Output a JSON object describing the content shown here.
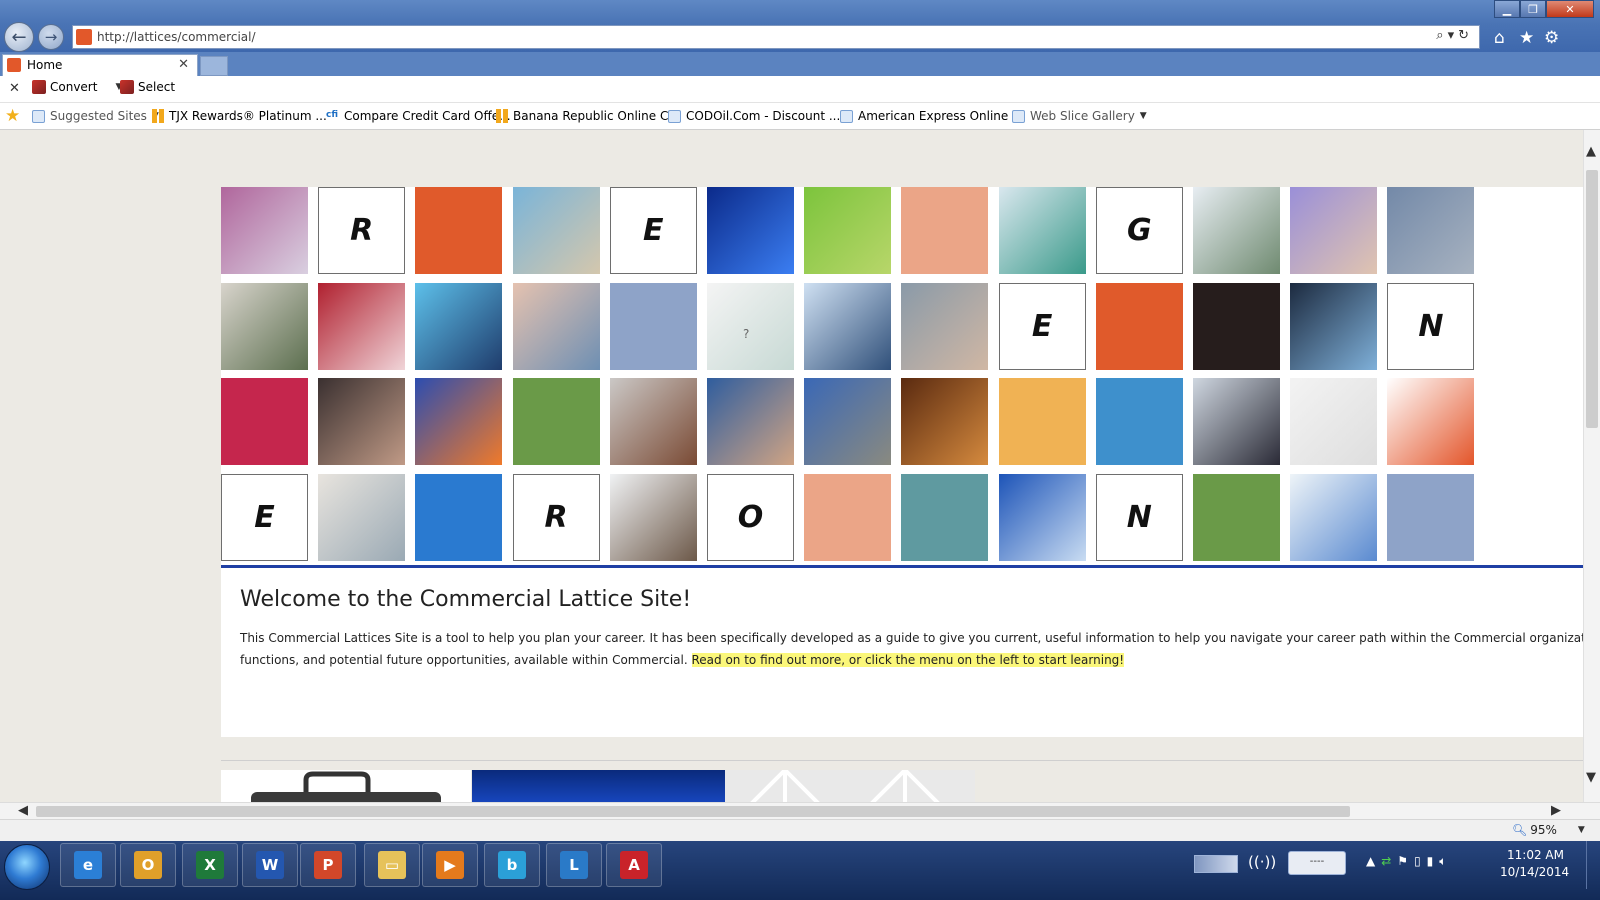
{
  "browser": {
    "address": "http://lattices/commercial/",
    "tab_label": "Home",
    "window_controls": {
      "minimize": "▁",
      "maximize": "❐",
      "close": "✕"
    },
    "icons": {
      "back": "back-arrow-icon",
      "forward": "forward-arrow-icon",
      "home": "home-icon",
      "favorites": "star-icon",
      "tools": "gear-icon",
      "search": "search-icon",
      "refresh": "refresh-icon"
    }
  },
  "commandbar": {
    "close_symbol": "✕",
    "convert_label": "Convert",
    "select_label": "Select"
  },
  "favorites": [
    {
      "label": "Suggested Sites",
      "icon": "ie-page-icon",
      "dropdown": true
    },
    {
      "label": "TJX Rewards® Platinum ...",
      "icon": "bars-icon"
    },
    {
      "label": "Compare Credit Card Offe...",
      "icon": "cc-icon"
    },
    {
      "label": "Banana Republic Online C...",
      "icon": "bars-icon"
    },
    {
      "label": "CODOil.Com - Discount ...",
      "icon": "ie-page-icon"
    },
    {
      "label": "American Express  Online ...",
      "icon": "ie-page-icon"
    },
    {
      "label": "Web Slice Gallery",
      "icon": "ie-page-icon",
      "dropdown": true
    }
  ],
  "mosaic": {
    "rows": [
      [
        {
          "type": "photo",
          "desc": "purple-tissue",
          "color": "#b0669c",
          "color2": "#d9cfe0"
        },
        {
          "type": "letter",
          "text": "R"
        },
        {
          "type": "color",
          "color": "#e05a2b"
        },
        {
          "type": "photo",
          "desc": "beach-couple",
          "color": "#7ab4d8",
          "color2": "#d4c7ad"
        },
        {
          "type": "letter",
          "text": "E"
        },
        {
          "type": "photo",
          "desc": "blue-molecule",
          "color": "#0b2a8a",
          "color2": "#3b7ef2"
        },
        {
          "type": "photo",
          "desc": "green-antibody",
          "color": "#7cc43c",
          "color2": "#b8d66a"
        },
        {
          "type": "color",
          "color": "#eba587"
        },
        {
          "type": "photo",
          "desc": "lab-scientist",
          "color": "#d9e7ee",
          "color2": "#3a9a8a"
        },
        {
          "type": "letter",
          "text": "G"
        },
        {
          "type": "photo",
          "desc": "office-presentation",
          "color": "#e7edf2",
          "color2": "#6f8a70"
        },
        {
          "type": "photo",
          "desc": "woman-portrait",
          "color": "#9a8fd8",
          "color2": "#e0c4b0"
        },
        {
          "type": "photo",
          "desc": "factory-floor",
          "color": "#7389a8",
          "color2": "#a7b2c0"
        }
      ],
      [
        {
          "type": "photo",
          "desc": "doctor-patient",
          "color": "#d8d4cc",
          "color2": "#5c6f4f"
        },
        {
          "type": "photo",
          "desc": "red-cells",
          "color": "#b0202f",
          "color2": "#f0d4d8"
        },
        {
          "type": "photo",
          "desc": "capsule-grid",
          "color": "#5dc0ea",
          "color2": "#1f3c6c"
        },
        {
          "type": "photo",
          "desc": "blue-eye",
          "color": "#e5c2b0",
          "color2": "#6e8fb2"
        },
        {
          "type": "color",
          "color": "#8ea3c8"
        },
        {
          "type": "photo",
          "desc": "vial",
          "color": "#f4f4f4",
          "color2": "#c7d9d4",
          "text": "?"
        },
        {
          "type": "photo",
          "desc": "hands-document",
          "color": "#cfe0f2",
          "color2": "#30507a"
        },
        {
          "type": "photo",
          "desc": "man-portrait",
          "color": "#8a9aa8",
          "color2": "#d0b7a4"
        },
        {
          "type": "letter",
          "text": "E"
        },
        {
          "type": "color",
          "color": "#e05a2b"
        },
        {
          "type": "color",
          "color": "#261d1c"
        },
        {
          "type": "photo",
          "desc": "trade-booth",
          "color": "#1c2a3f",
          "color2": "#7fb0d9"
        },
        {
          "type": "letter",
          "text": "N"
        }
      ],
      [
        {
          "type": "color",
          "color": "#c5264d"
        },
        {
          "type": "photo",
          "desc": "group-photo",
          "color": "#3a3030",
          "color2": "#c09a86"
        },
        {
          "type": "photo",
          "desc": "team-blue",
          "color": "#2c4db0",
          "color2": "#f07a2a"
        },
        {
          "type": "color",
          "color": "#6a9a48"
        },
        {
          "type": "photo",
          "desc": "curly-hair-woman",
          "color": "#cbc8c6",
          "color2": "#7a4a34"
        },
        {
          "type": "photo",
          "desc": "crowd",
          "color": "#2f5d9e",
          "color2": "#d0a484"
        },
        {
          "type": "photo",
          "desc": "road",
          "color": "#3a68b6",
          "color2": "#8a8a80"
        },
        {
          "type": "photo",
          "desc": "retina",
          "color": "#5a2a10",
          "color2": "#d58a3e"
        },
        {
          "type": "color",
          "color": "#f0b254"
        },
        {
          "type": "color",
          "color": "#3e90cc"
        },
        {
          "type": "photo",
          "desc": "man-suit",
          "color": "#cfd7e0",
          "color2": "#2a2a36"
        },
        {
          "type": "photo",
          "desc": "white-geometric",
          "color": "#f3f3f3",
          "color2": "#dedede"
        },
        {
          "type": "photo",
          "desc": "ribbon",
          "color": "#ffffff",
          "color2": "#e3552a"
        }
      ],
      [
        {
          "type": "letter",
          "text": "E"
        },
        {
          "type": "photo",
          "desc": "doctors-older",
          "color": "#e8e4de",
          "color2": "#9aa9b4"
        },
        {
          "type": "color",
          "color": "#2a7ad0"
        },
        {
          "type": "letter",
          "text": "R"
        },
        {
          "type": "photo",
          "desc": "microscope",
          "color": "#f0f2f4",
          "color2": "#6c5848"
        },
        {
          "type": "letter",
          "text": "O"
        },
        {
          "type": "color",
          "color": "#eba587"
        },
        {
          "type": "color",
          "color": "#5f9aa0"
        },
        {
          "type": "photo",
          "desc": "lab-blue",
          "color": "#1d54b8",
          "color2": "#c9dcf2"
        },
        {
          "type": "letter",
          "text": "N"
        },
        {
          "type": "color",
          "color": "#6a9a48"
        },
        {
          "type": "photo",
          "desc": "globe-pills",
          "color": "#eef4f8",
          "color2": "#5a8ad0"
        },
        {
          "type": "color",
          "color": "#8ea3c8"
        }
      ]
    ]
  },
  "welcome": {
    "title": "Welcome to the Commercial Lattice Site!",
    "body_line1": "This Commercial Lattices Site is a tool to help you plan your career. It has been specifically developed as a guide to give you current, useful information to help you navigate your career path within the Commercial organization. This Site will giv",
    "body_line2": "functions, and potential future opportunities, available within Commercial. ",
    "highlight": "Read on to find out more, or click the menu on the left to start learning!"
  },
  "statusbar": {
    "zoom": "95%"
  },
  "taskbar": {
    "apps": [
      {
        "name": "internet-explorer",
        "symbol": "e",
        "color": "#2b7fd6"
      },
      {
        "name": "outlook",
        "symbol": "O",
        "color": "#e0a02a"
      },
      {
        "name": "excel",
        "symbol": "X",
        "color": "#1f7a3a"
      },
      {
        "name": "word",
        "symbol": "W",
        "color": "#2457b0"
      },
      {
        "name": "powerpoint",
        "symbol": "P",
        "color": "#d2472a"
      },
      {
        "name": "file-explorer",
        "symbol": "▭",
        "color": "#e6c25a"
      },
      {
        "name": "media-player",
        "symbol": "▶",
        "color": "#e47a1c"
      },
      {
        "name": "app-b",
        "symbol": "b",
        "color": "#2ba0d8"
      },
      {
        "name": "lync",
        "symbol": "L",
        "color": "#2a7ac8"
      },
      {
        "name": "acrobat",
        "symbol": "A",
        "color": "#c9232a"
      }
    ],
    "tray_box": "----",
    "time": "11:02 AM",
    "date": "10/14/2014"
  }
}
